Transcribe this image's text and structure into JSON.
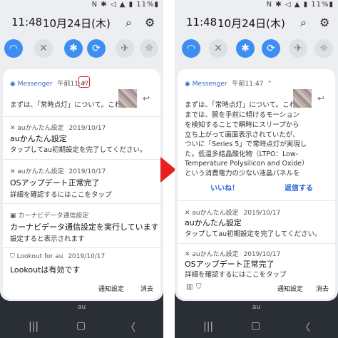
{
  "status": {
    "icons": "N ✱ ◁ ▲ ▮ 11%▮"
  },
  "topbar": {
    "time": "11:48",
    "date": "10月24日(木)"
  },
  "quick_settings": [
    "wifi",
    "mute",
    "bluetooth",
    "rotate",
    "airplane",
    "flashlight"
  ],
  "left": {
    "messenger": {
      "app": "Messenger",
      "time": "午前11:47",
      "body": "まずは、「常時点灯」について。これ"
    },
    "au1": {
      "app": "auかんたん設定",
      "date": "2019/10/17",
      "title": "auかんたん設定",
      "body": "タップしてau初期設定を完了してください。"
    },
    "au2": {
      "app": "auかんたん設定",
      "date": "2019/10/17",
      "title": "OSアップデート正常完了",
      "body": "詳細を確認するにはここをタップ"
    },
    "car": {
      "app": "カーナビデータ通信設定",
      "title": "カーナビデータ通信設定を実行しています",
      "body": "設定すると表示されます"
    },
    "lookout": {
      "app": "Lookout for au",
      "date": "2019/10/17",
      "title": "Lookoutは有効です"
    },
    "footer": {
      "settings": "通知設定",
      "clear": "消去"
    }
  },
  "right": {
    "messenger": {
      "app": "Messenger",
      "time": "午前11:47",
      "lines": [
        "まずは、「常時点灯」について。これ",
        "までは、腕を手前に傾けるモーション",
        "を検知することで瞬時にスリープから",
        "立ち上がって画面表示されていたが、",
        "ついに「Series 5」で常時点灯が実現し",
        "た。低温多結晶酸化物（LTPO：Low-",
        "Temperature Polysilicon and Oxide）",
        "という消費電力の少ない液晶パネルを"
      ],
      "like": "いいね！",
      "reply": "返信する"
    },
    "au1": {
      "app": "auかんたん設定",
      "date": "2019/10/17",
      "title": "auかんたん設定",
      "body": "タップしてau初期設定を完了してください。"
    },
    "au2": {
      "app": "auかんたん設定",
      "date": "2019/10/17",
      "title": "OSアップデート正常完了",
      "body": "詳細を確認するにはここをタップ"
    },
    "footer": {
      "settings": "通知設定",
      "clear": "消去"
    }
  },
  "bottom": {
    "carrier": "au"
  }
}
